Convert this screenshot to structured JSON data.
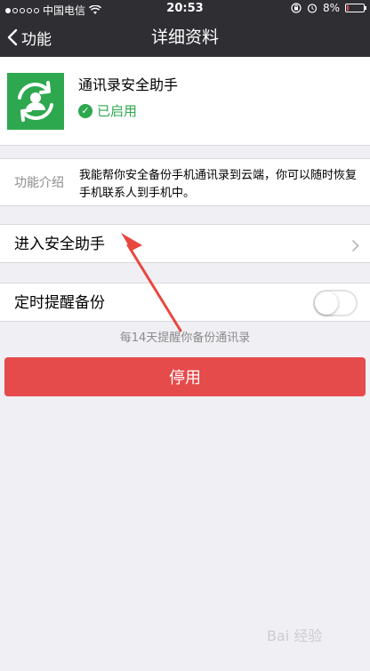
{
  "status_bar": {
    "carrier": "中国电信",
    "time": "20:53",
    "battery_percent": "8%",
    "battery_level": 0.08,
    "signal_bars": 1,
    "battery_color": "#e04b4b"
  },
  "nav": {
    "back_label": "功能",
    "title": "详细资料"
  },
  "app": {
    "name": "通讯录安全助手",
    "status": "已启用",
    "icon": "contacts-sync-icon",
    "color": "#2ea84f"
  },
  "intro": {
    "label": "功能介绍",
    "text": "我能帮你安全备份手机通讯录到云端，你可以随时恢复手机联系人到手机中。"
  },
  "enter_row": {
    "label": "进入安全助手"
  },
  "backup_row": {
    "label": "定时提醒备份",
    "enabled": false,
    "hint": "每14天提醒你备份通讯录"
  },
  "disable_button": {
    "label": "停用",
    "color": "#e64b4b"
  },
  "watermark": {
    "text": "Bai 经验"
  }
}
